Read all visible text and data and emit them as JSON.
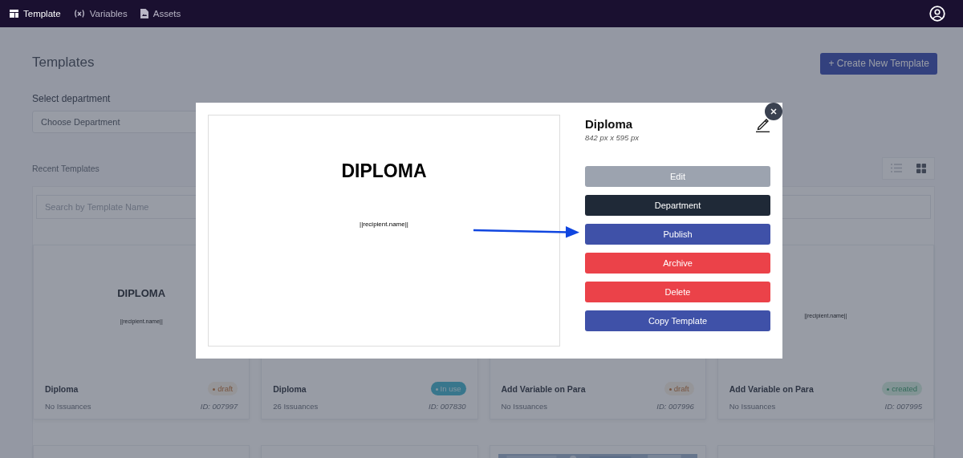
{
  "nav": {
    "tabs": [
      {
        "label": "Template",
        "selected": true
      },
      {
        "label": "Variables",
        "selected": false
      },
      {
        "label": "Assets",
        "selected": false
      }
    ]
  },
  "page": {
    "title": "Templates",
    "create_button": "+ Create New Template",
    "department_label": "Select department",
    "department_placeholder": "Choose Department",
    "recent_label": "Recent Templates",
    "views": [
      {
        "kind": "list",
        "selected": false
      },
      {
        "kind": "grid",
        "selected": true
      }
    ],
    "search": {
      "placeholder": "Search by Template Name"
    },
    "cards": [
      {
        "preview_heading": "DIPLOMA",
        "preview_field": "||recipient.name||",
        "name": "Diploma",
        "status": {
          "label": "draft",
          "kind": "draft"
        },
        "issuances": "No Issuances",
        "id": "ID: 007997"
      },
      {
        "name": "Diploma",
        "status": {
          "label": "In use",
          "kind": "in_use"
        },
        "issuances": "26 Issuances",
        "id": "ID: 007830"
      },
      {
        "name": "Add Variable on Para",
        "status": {
          "label": "draft",
          "kind": "draft"
        },
        "issuances": "No Issuances",
        "id": "ID: 007996"
      },
      {
        "preview_field": "||recipient.name||",
        "name": "Add Variable on Para",
        "status": {
          "label": "created",
          "kind": "created"
        },
        "issuances": "No Issuances",
        "id": "ID: 007995"
      }
    ],
    "next_cards": [
      {
        "kind": "blank"
      },
      {
        "kind": "blank"
      },
      {
        "kind": "picture"
      },
      {
        "kind": "blank"
      }
    ]
  },
  "modal": {
    "title": "Diploma",
    "size": "842 px x 595 px",
    "preview_heading": "DIPLOMA",
    "preview_field": "||recipient.name||",
    "actions": [
      {
        "label": "Edit",
        "kind": "muted"
      },
      {
        "label": "Department",
        "kind": "dark"
      },
      {
        "label": "Publish",
        "kind": "primary"
      },
      {
        "label": "Archive",
        "kind": "danger"
      },
      {
        "label": "Delete",
        "kind": "danger"
      },
      {
        "label": "Copy Template",
        "kind": "primary"
      }
    ]
  }
}
